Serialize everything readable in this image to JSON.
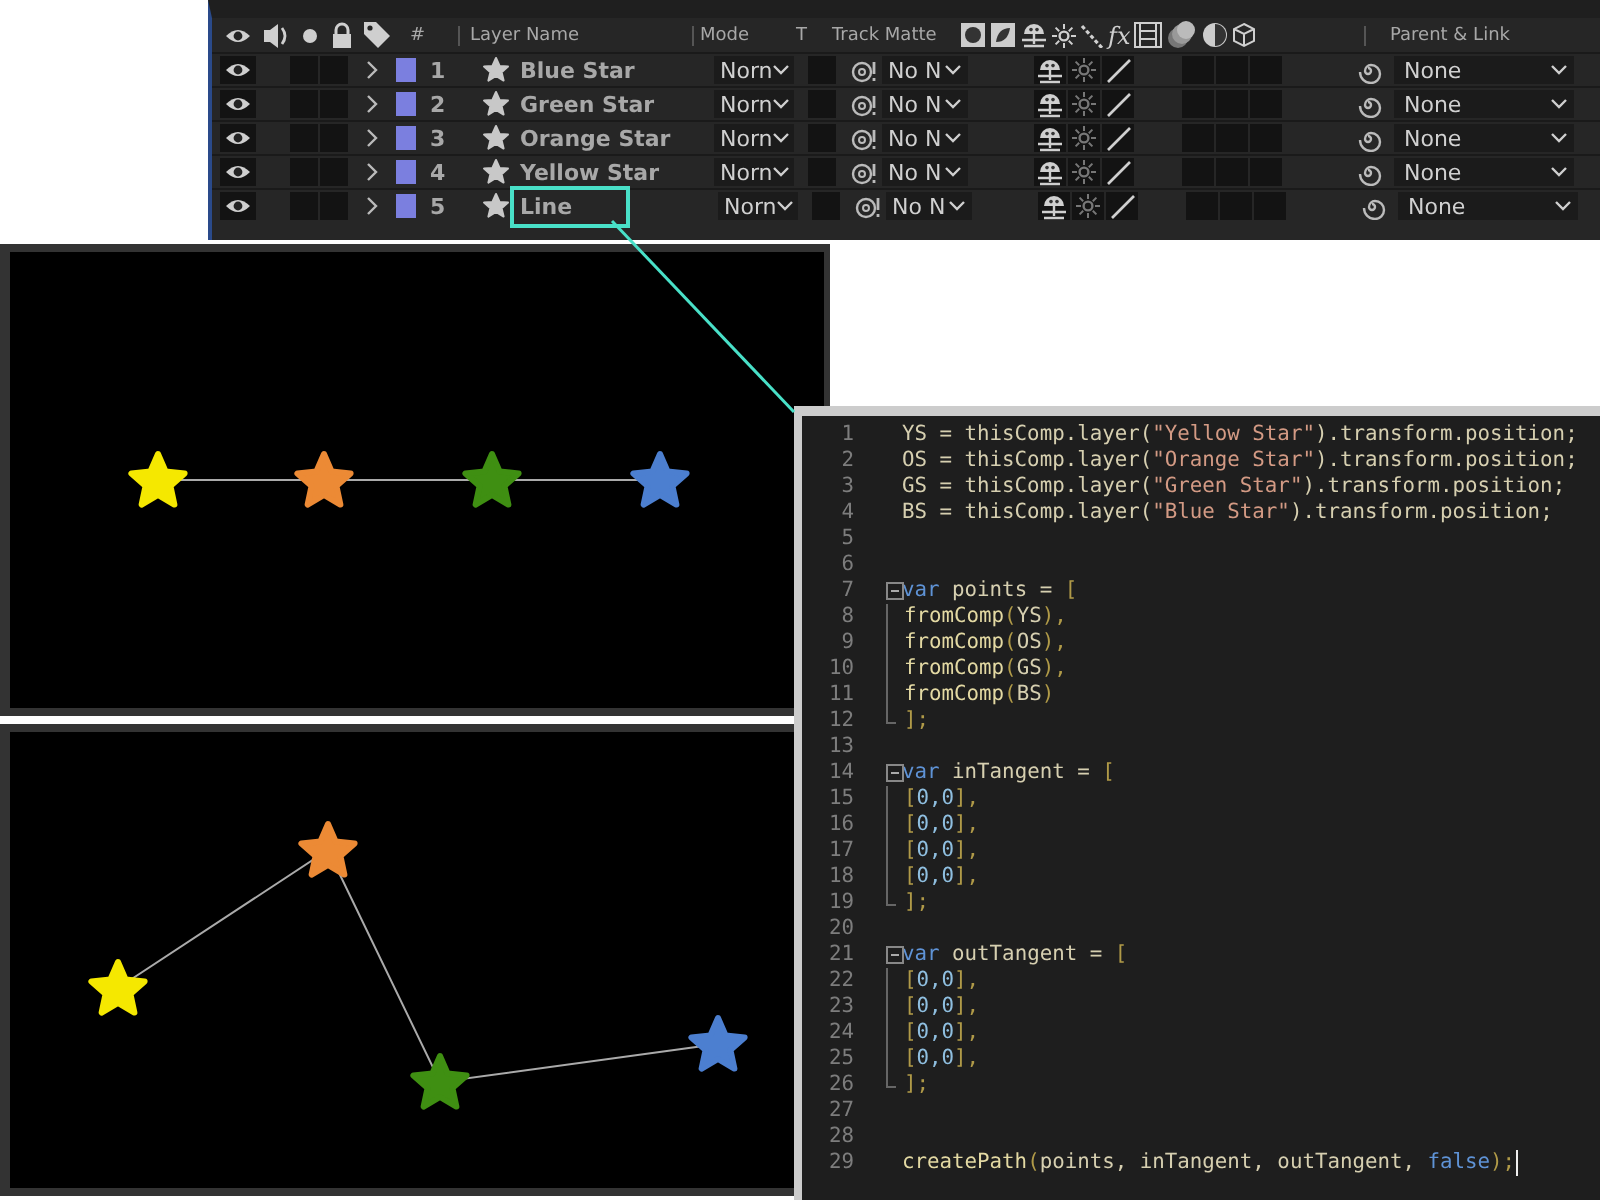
{
  "timeline": {
    "header": {
      "number": "#",
      "layer_name": "Layer Name",
      "mode": "Mode",
      "preserve": "T",
      "track_matte": "Track Matte",
      "effects": "fx",
      "parent": "Parent & Link"
    },
    "layers": [
      {
        "number": "1",
        "name": "Blue Star",
        "color": "#7b7fdf",
        "visible": true,
        "mode": "Norn",
        "track_matte": "No N",
        "parent": "None",
        "highlighted": false
      },
      {
        "number": "2",
        "name": "Green Star",
        "color": "#7b7fdf",
        "visible": true,
        "mode": "Norn",
        "track_matte": "No N",
        "parent": "None",
        "highlighted": false
      },
      {
        "number": "3",
        "name": "Orange Star",
        "color": "#7b7fdf",
        "visible": true,
        "mode": "Norn",
        "track_matte": "No N",
        "parent": "None",
        "highlighted": false
      },
      {
        "number": "4",
        "name": "Yellow Star",
        "color": "#7b7fdf",
        "visible": true,
        "mode": "Norn",
        "track_matte": "No N",
        "parent": "None",
        "highlighted": false
      },
      {
        "number": "5",
        "name": "Line",
        "color": "#7b7fdf",
        "visible": true,
        "mode": "Norn",
        "track_matte": "No N",
        "parent": "None",
        "highlighted": true
      }
    ]
  },
  "viewers": [
    {
      "stars": [
        {
          "color": "#f5e800"
        },
        {
          "color": "#ec8a35"
        },
        {
          "color": "#3f8f12"
        },
        {
          "color": "#4c7fd0"
        }
      ]
    },
    {
      "stars": [
        {
          "color": "#f5e800"
        },
        {
          "color": "#ec8a35"
        },
        {
          "color": "#3f8f12"
        },
        {
          "color": "#4c7fd0"
        }
      ]
    }
  ],
  "editor": {
    "lines": [
      {
        "number": "1",
        "tokens": [
          {
            "kind": "plain",
            "text": "YS = thisComp.layer("
          },
          {
            "kind": "string",
            "text": "\"Yellow Star\""
          },
          {
            "kind": "plain",
            "text": ").transform.position;"
          }
        ]
      },
      {
        "number": "2",
        "tokens": [
          {
            "kind": "plain",
            "text": "OS = thisComp.layer("
          },
          {
            "kind": "string",
            "text": "\"Orange Star\""
          },
          {
            "kind": "plain",
            "text": ").transform.position;"
          }
        ]
      },
      {
        "number": "3",
        "tokens": [
          {
            "kind": "plain",
            "text": "GS = thisComp.layer("
          },
          {
            "kind": "string",
            "text": "\"Green Star\""
          },
          {
            "kind": "plain",
            "text": ").transform.position;"
          }
        ]
      },
      {
        "number": "4",
        "tokens": [
          {
            "kind": "plain",
            "text": "BS = thisComp.layer("
          },
          {
            "kind": "string",
            "text": "\"Blue Star\""
          },
          {
            "kind": "plain",
            "text": ").transform.position;"
          }
        ]
      },
      {
        "number": "5"
      },
      {
        "number": "6"
      },
      {
        "number": "7",
        "expanded": true,
        "tokens": [
          {
            "kind": "keyword",
            "text": "var"
          },
          {
            "kind": "plain",
            "text": " points = "
          },
          {
            "kind": "bracket",
            "text": "["
          }
        ],
        "children": [
          {
            "number": "8",
            "tokens": [
              {
                "kind": "func",
                "text": "fromComp"
              },
              {
                "kind": "bracket",
                "text": "("
              },
              {
                "kind": "plain",
                "text": "YS"
              },
              {
                "kind": "bracket",
                "text": "),"
              }
            ]
          },
          {
            "number": "9",
            "tokens": [
              {
                "kind": "func",
                "text": "fromComp"
              },
              {
                "kind": "bracket",
                "text": "("
              },
              {
                "kind": "plain",
                "text": "OS"
              },
              {
                "kind": "bracket",
                "text": "),"
              }
            ]
          },
          {
            "number": "10",
            "tokens": [
              {
                "kind": "func",
                "text": "fromComp"
              },
              {
                "kind": "bracket",
                "text": "("
              },
              {
                "kind": "plain",
                "text": "GS"
              },
              {
                "kind": "bracket",
                "text": "),"
              }
            ]
          },
          {
            "number": "11",
            "tokens": [
              {
                "kind": "func",
                "text": "fromComp"
              },
              {
                "kind": "bracket",
                "text": "("
              },
              {
                "kind": "plain",
                "text": "BS"
              },
              {
                "kind": "bracket",
                "text": ")"
              }
            ]
          },
          {
            "number": "12",
            "tokens": [
              {
                "kind": "bracket",
                "text": "];"
              }
            ]
          }
        ]
      },
      {
        "number": "13"
      },
      {
        "number": "14",
        "expanded": true,
        "tokens": [
          {
            "kind": "keyword",
            "text": "var"
          },
          {
            "kind": "plain",
            "text": " inTangent = "
          },
          {
            "kind": "bracket",
            "text": "["
          }
        ],
        "children": [
          {
            "number": "15",
            "tokens": [
              {
                "kind": "bracket",
                "text": "["
              },
              {
                "kind": "number",
                "text": "0,0"
              },
              {
                "kind": "bracket",
                "text": "],"
              }
            ]
          },
          {
            "number": "16",
            "tokens": [
              {
                "kind": "bracket",
                "text": "["
              },
              {
                "kind": "number",
                "text": "0,0"
              },
              {
                "kind": "bracket",
                "text": "],"
              }
            ]
          },
          {
            "number": "17",
            "tokens": [
              {
                "kind": "bracket",
                "text": "["
              },
              {
                "kind": "number",
                "text": "0,0"
              },
              {
                "kind": "bracket",
                "text": "],"
              }
            ]
          },
          {
            "number": "18",
            "tokens": [
              {
                "kind": "bracket",
                "text": "["
              },
              {
                "kind": "number",
                "text": "0,0"
              },
              {
                "kind": "bracket",
                "text": "],"
              }
            ]
          },
          {
            "number": "19",
            "tokens": [
              {
                "kind": "bracket",
                "text": "];"
              }
            ]
          }
        ]
      },
      {
        "number": "20"
      },
      {
        "number": "21",
        "expanded": true,
        "tokens": [
          {
            "kind": "keyword",
            "text": "var"
          },
          {
            "kind": "plain",
            "text": " outTangent = "
          },
          {
            "kind": "bracket",
            "text": "["
          }
        ],
        "children": [
          {
            "number": "22",
            "tokens": [
              {
                "kind": "bracket",
                "text": "["
              },
              {
                "kind": "number",
                "text": "0,0"
              },
              {
                "kind": "bracket",
                "text": "],"
              }
            ]
          },
          {
            "number": "23",
            "tokens": [
              {
                "kind": "bracket",
                "text": "["
              },
              {
                "kind": "number",
                "text": "0,0"
              },
              {
                "kind": "bracket",
                "text": "],"
              }
            ]
          },
          {
            "number": "24",
            "tokens": [
              {
                "kind": "bracket",
                "text": "["
              },
              {
                "kind": "number",
                "text": "0,0"
              },
              {
                "kind": "bracket",
                "text": "],"
              }
            ]
          },
          {
            "number": "25",
            "tokens": [
              {
                "kind": "bracket",
                "text": "["
              },
              {
                "kind": "number",
                "text": "0,0"
              },
              {
                "kind": "bracket",
                "text": "],"
              }
            ]
          },
          {
            "number": "26",
            "tokens": [
              {
                "kind": "bracket",
                "text": "];"
              }
            ]
          }
        ]
      },
      {
        "number": "27"
      },
      {
        "number": "28"
      },
      {
        "number": "29",
        "tokens": [
          {
            "kind": "func",
            "text": "createPath"
          },
          {
            "kind": "bracket",
            "text": "("
          },
          {
            "kind": "plain",
            "text": "points, inTangent, outTangent, "
          },
          {
            "kind": "keyword",
            "text": "false"
          },
          {
            "kind": "bracket",
            "text": ");"
          }
        ]
      }
    ]
  }
}
